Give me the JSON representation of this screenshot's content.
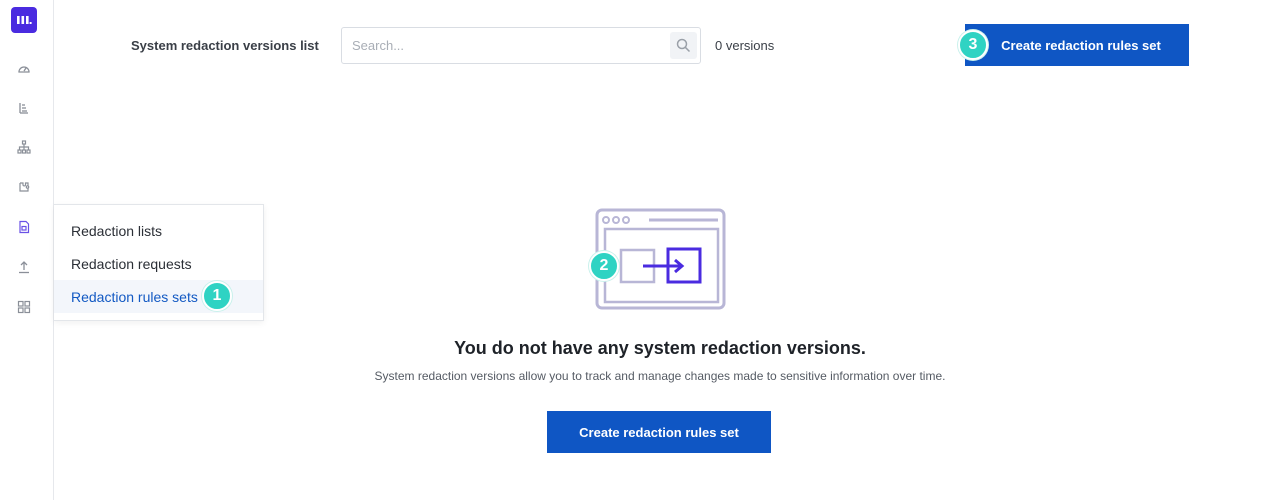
{
  "sidebar": {
    "logo_icon": "brand-logo",
    "items": [
      {
        "icon": "dashboard-gauge-icon"
      },
      {
        "icon": "reports-list-icon"
      },
      {
        "icon": "hierarchy-icon"
      },
      {
        "icon": "integrations-icon"
      },
      {
        "icon": "redaction-document-icon"
      },
      {
        "icon": "upload-icon"
      },
      {
        "icon": "apps-grid-icon"
      }
    ]
  },
  "flyout": {
    "items": [
      {
        "label": "Redaction lists"
      },
      {
        "label": "Redaction requests"
      },
      {
        "label": "Redaction rules sets",
        "active": true
      }
    ]
  },
  "header": {
    "title": "System redaction versions list",
    "search_placeholder": "Search...",
    "search_value": "",
    "count_text": "0 versions",
    "create_button": "Create redaction rules set"
  },
  "empty_state": {
    "title": "You do not have any system redaction versions.",
    "description": "System redaction versions allow you to track and manage changes made to sensitive information over time.",
    "button": "Create redaction rules set"
  },
  "badges": [
    "1",
    "2",
    "3"
  ],
  "colors": {
    "brand": "#4a2be0",
    "primary_button": "#0f56c4",
    "badge": "#2fd3c3",
    "active_link": "#1259c3",
    "illustration_light": "#b8b6d6",
    "illustration_accent": "#4a2be0"
  }
}
